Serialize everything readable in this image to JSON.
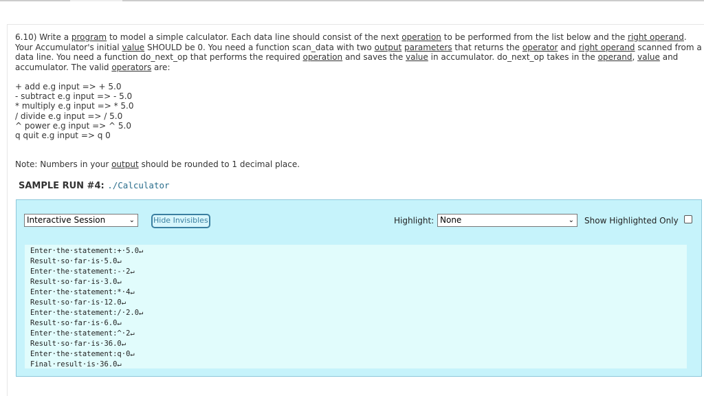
{
  "question": {
    "segments": [
      {
        "t": "6.10) Write a "
      },
      {
        "t": "program",
        "u": true
      },
      {
        "t": " to model a simple calculator. Each data line should consist of the next "
      },
      {
        "t": "operation",
        "u": true
      },
      {
        "t": " to be performed from the list below and the "
      },
      {
        "t": "right operand",
        "u": true
      },
      {
        "t": ". Your Accumulator's initial "
      },
      {
        "t": "value",
        "u": true
      },
      {
        "t": " SHOULD be 0. You need a function scan_data with two "
      },
      {
        "t": "output",
        "u": true
      },
      {
        "t": " "
      },
      {
        "t": "parameters",
        "u": true
      },
      {
        "t": " that returns the "
      },
      {
        "t": "operator",
        "u": true
      },
      {
        "t": " and "
      },
      {
        "t": "right operand",
        "u": true
      },
      {
        "t": " scanned from a data line. You need a function do_next_op that performs the required "
      },
      {
        "t": "operation",
        "u": true
      },
      {
        "t": " and saves the "
      },
      {
        "t": "value",
        "u": true
      },
      {
        "t": " in accumulator. do_next_op takes in the "
      },
      {
        "t": "operand",
        "u": true
      },
      {
        "t": ", "
      },
      {
        "t": "value",
        "u": true
      },
      {
        "t": " and accumulator. The valid "
      },
      {
        "t": "operators",
        "u": true
      },
      {
        "t": " are:"
      }
    ],
    "operators": [
      "+ add e.g input => + 5.0",
      "- subtract e.g input => - 5.0",
      "* multiply e.g input => * 5.0",
      "/ divide e.g input => / 5.0",
      "^ power e.g input => ^ 5.0",
      "q quit e.g input => q 0"
    ],
    "note_before": "Note: Numbers in your ",
    "note_link": "output",
    "note_after": " should be rounded to 1 decimal place."
  },
  "sample": {
    "label": "SAMPLE RUN #4: ",
    "command": "./Calculator"
  },
  "panel": {
    "session_select": "Interactive Session",
    "hide_invisibles": "Hide Invisibles",
    "highlight_label": "Highlight:",
    "highlight_value": "None",
    "show_highlighted_only": "Show Highlighted Only",
    "show_highlighted_checked": false,
    "output_lines": [
      "Enter·the·statement:+·5.0↵",
      "Result·so·far·is·5.0↵",
      "Enter·the·statement:-·2↵",
      "Result·so·far·is·3.0↵",
      "Enter·the·statement:*·4↵",
      "Result·so·far·is·12.0↵",
      "Enter·the·statement:/·2.0↵",
      "Result·so·far·is·6.0↵",
      "Enter·the·statement:^·2↵",
      "Result·so·far·is·36.0↵",
      "Enter·the·statement:q·0↵",
      "Final·result·is·36.0↵"
    ]
  }
}
